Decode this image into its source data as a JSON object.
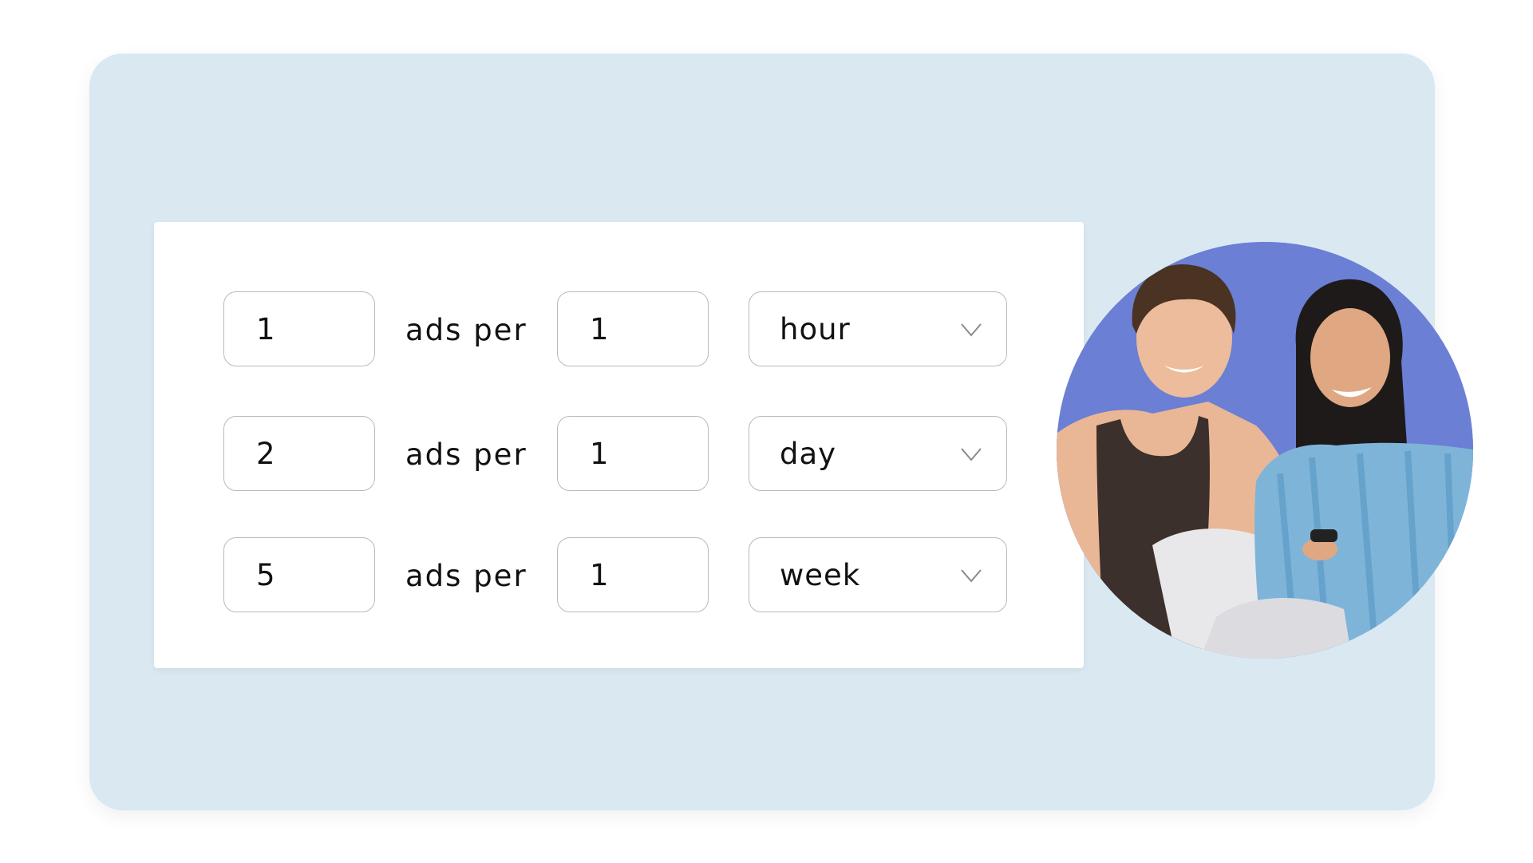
{
  "colors": {
    "page_background": "#ffffff",
    "card_background": "#dae8f1",
    "panel_background": "#ffffff",
    "field_border": "#b9b9b9",
    "text": "#111111",
    "chevron": "#8a8a8a",
    "photo_background": "#6b7fd4"
  },
  "frequency_rules": [
    {
      "ads_count": "1",
      "connector": "ads per",
      "period_count": "1",
      "period_unit": "hour",
      "icon": "chevron-down-icon"
    },
    {
      "ads_count": "2",
      "connector": "ads per",
      "period_count": "1",
      "period_unit": "day",
      "icon": "chevron-down-icon"
    },
    {
      "ads_count": "5",
      "connector": "ads per",
      "period_count": "1",
      "period_unit": "week",
      "icon": "chevron-down-icon"
    }
  ],
  "photo": {
    "description": "Two people smiling while watching TV, one holding a remote, on a blue background"
  }
}
